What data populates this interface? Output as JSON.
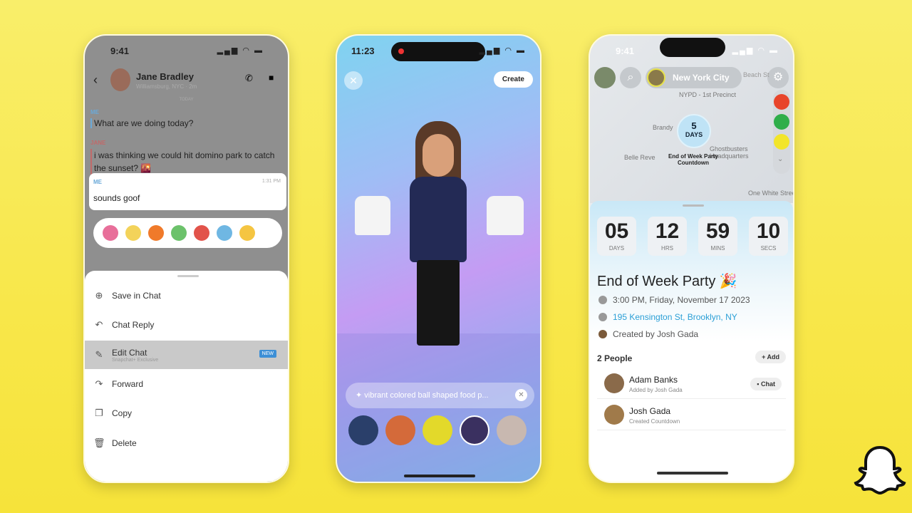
{
  "chat": {
    "time": "9:41",
    "contact": "Jane Bradley",
    "subtitle": "Williamsburg, NYC · 2m",
    "day": "TODAY",
    "messages": [
      {
        "sender": "ME",
        "text": "What are we doing today?"
      },
      {
        "sender": "JANE",
        "text": "i was thinking we could hit domino park to catch the sunset? 🌇"
      }
    ],
    "selected": {
      "sender": "ME",
      "time": "1:31 PM",
      "text": "sounds goof"
    },
    "menu": [
      {
        "icon": "save-icon",
        "label": "Save in Chat"
      },
      {
        "icon": "reply-icon",
        "label": "Chat Reply"
      },
      {
        "icon": "pencil-icon",
        "label": "Edit Chat",
        "sub": "Snapchat+ Exclusive",
        "badge": "NEW"
      },
      {
        "icon": "forward-icon",
        "label": "Forward"
      },
      {
        "icon": "copy-icon",
        "label": "Copy"
      },
      {
        "icon": "trash-icon",
        "label": "Delete"
      }
    ]
  },
  "bitmoji": {
    "time": "11:23",
    "create": "Create",
    "prompt": "vibrant colored ball shaped food p..."
  },
  "map": {
    "time": "9:41",
    "city": "New York City",
    "labels": [
      "NYPD - 1st Precinct",
      "Brandy",
      "Belle Reve",
      "Ghostbusters Headquarters",
      "One White Street",
      "Beach St"
    ],
    "pin": {
      "num": "5",
      "unit": "DAYS",
      "title": "End of Week Party",
      "sub": "Countdown"
    },
    "countdown": [
      {
        "v": "05",
        "u": "DAYS"
      },
      {
        "v": "12",
        "u": "HRS"
      },
      {
        "v": "59",
        "u": "MINS"
      },
      {
        "v": "10",
        "u": "SECS"
      }
    ],
    "event": "End of Week Party 🎉",
    "when": "3:00 PM, Friday, November 17 2023",
    "where": "195 Kensington St, Brooklyn, NY",
    "creator": "Created by Josh Gada",
    "people_count": "2 People",
    "add": "+ Add",
    "people": [
      {
        "name": "Adam Banks",
        "sub": "Added by Josh Gada",
        "action": "Chat"
      },
      {
        "name": "Josh Gada",
        "sub": "Created Countdown"
      }
    ]
  },
  "colors": {
    "background": "#f8e74a",
    "link": "#2a9fd6",
    "badge": "#3d8fd6"
  }
}
